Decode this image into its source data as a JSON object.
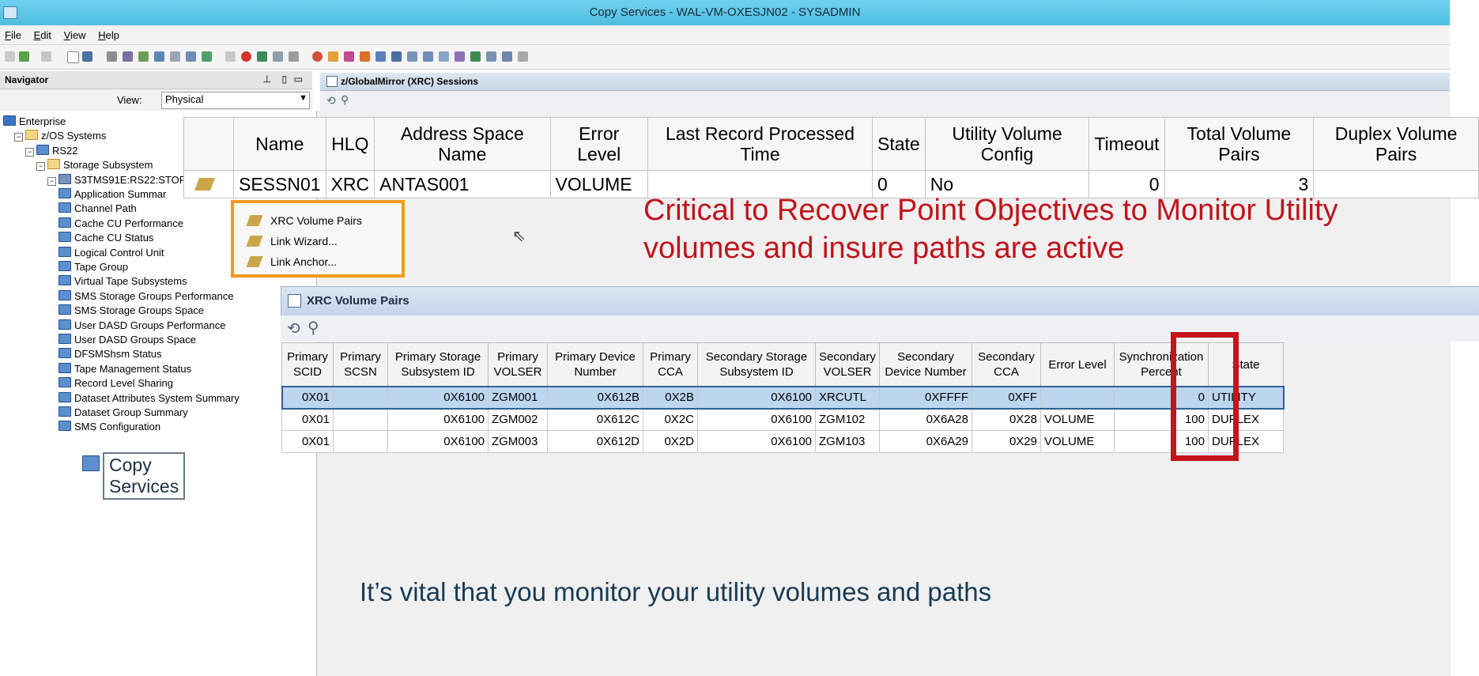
{
  "window": {
    "title": "Copy Services - WAL-VM-OXESJN02 - SYSADMIN"
  },
  "menu": [
    "File",
    "Edit",
    "View",
    "Help"
  ],
  "navigator": {
    "title": "Navigator",
    "view_label": "View:",
    "view_value": "Physical",
    "tree": [
      {
        "label": "Enterprise",
        "indent": 0,
        "icon": "grid"
      },
      {
        "label": "z/OS Systems",
        "indent": 1,
        "icon": "folder",
        "exp": "−"
      },
      {
        "label": "RS22",
        "indent": 2,
        "icon": "server",
        "exp": "−"
      },
      {
        "label": "Storage Subsystem",
        "indent": 3,
        "icon": "folder",
        "exp": "−"
      },
      {
        "label": "S3TMS91E:RS22:STOR",
        "indent": 4,
        "icon": "disk",
        "exp": "−"
      },
      {
        "label": "Application Summar",
        "indent": 5,
        "icon": "monitor"
      },
      {
        "label": "Channel Path",
        "indent": 5,
        "icon": "monitor"
      },
      {
        "label": "Cache CU Performance",
        "indent": 5,
        "icon": "monitor"
      },
      {
        "label": "Cache CU Status",
        "indent": 5,
        "icon": "monitor"
      },
      {
        "label": "Logical Control Unit",
        "indent": 5,
        "icon": "monitor"
      },
      {
        "label": "Tape Group",
        "indent": 5,
        "icon": "monitor"
      },
      {
        "label": "Virtual Tape Subsystems",
        "indent": 5,
        "icon": "monitor"
      },
      {
        "label": "SMS Storage Groups Performance",
        "indent": 5,
        "icon": "monitor"
      },
      {
        "label": "SMS Storage Groups Space",
        "indent": 5,
        "icon": "monitor"
      },
      {
        "label": "User DASD Groups Performance",
        "indent": 5,
        "icon": "monitor"
      },
      {
        "label": "User DASD Groups Space",
        "indent": 5,
        "icon": "monitor"
      },
      {
        "label": "DFSMShsm Status",
        "indent": 5,
        "icon": "monitor"
      },
      {
        "label": "Tape Management Status",
        "indent": 5,
        "icon": "monitor"
      },
      {
        "label": "Record Level Sharing",
        "indent": 5,
        "icon": "monitor"
      },
      {
        "label": "Dataset Attributes System Summary",
        "indent": 5,
        "icon": "monitor"
      },
      {
        "label": "Dataset Group Summary",
        "indent": 5,
        "icon": "monitor"
      },
      {
        "label": "SMS Configuration",
        "indent": 5,
        "icon": "monitor"
      }
    ],
    "copy_services": "Copy Services"
  },
  "sessions": {
    "panel_title": "z/GlobalMirror (XRC) Sessions",
    "columns": [
      "",
      "Name",
      "HLQ",
      "Address Space Name",
      "Error Level",
      "Last Record Processed Time",
      "State",
      "Utility Volume Config",
      "Timeout",
      "Total Volume Pairs",
      "Duplex Volume Pairs"
    ],
    "rows": [
      [
        "",
        "SESSN01",
        "XRC",
        "ANTAS001",
        "VOLUME",
        "",
        "0",
        "No",
        "0",
        "3",
        ""
      ]
    ]
  },
  "context_menu": [
    "XRC Volume Pairs",
    "Link Wizard...",
    "Link Anchor..."
  ],
  "annotation_red": "Critical to Recover Point Objectives to Monitor Utility volumes and insure paths are active",
  "pairs": {
    "title": "XRC Volume Pairs",
    "columns": [
      "Primary SCID",
      "Primary SCSN",
      "Primary Storage Subsystem ID",
      "Primary VOLSER",
      "Primary Device Number",
      "Primary CCA",
      "Secondary Storage Subsystem ID",
      "Secondary VOLSER",
      "Secondary Device Number",
      "Secondary CCA",
      "Error Level",
      "Synchronization Percent",
      "State"
    ],
    "rows": [
      [
        "0X01",
        "",
        "0X6100",
        "ZGM001",
        "0X612B",
        "0X2B",
        "0X6100",
        "XRCUTL",
        "0XFFFF",
        "0XFF",
        "",
        "0",
        "UTILITY"
      ],
      [
        "0X01",
        "",
        "0X6100",
        "ZGM002",
        "0X612C",
        "0X2C",
        "0X6100",
        "ZGM102",
        "0X6A28",
        "0X28",
        "VOLUME",
        "100",
        "DUPLEX"
      ],
      [
        "0X01",
        "",
        "0X6100",
        "ZGM003",
        "0X612D",
        "0X2D",
        "0X6100",
        "ZGM103",
        "0X6A29",
        "0X29",
        "VOLUME",
        "100",
        "DUPLEX"
      ]
    ]
  },
  "annotation_blue": "It’s vital that you monitor your utility volumes and paths",
  "colors": {
    "highlight_border": "#c4141c",
    "menu_border": "#f39a1e",
    "title_bar": "#4dbde0",
    "selected_row": "#bcd6f0"
  }
}
